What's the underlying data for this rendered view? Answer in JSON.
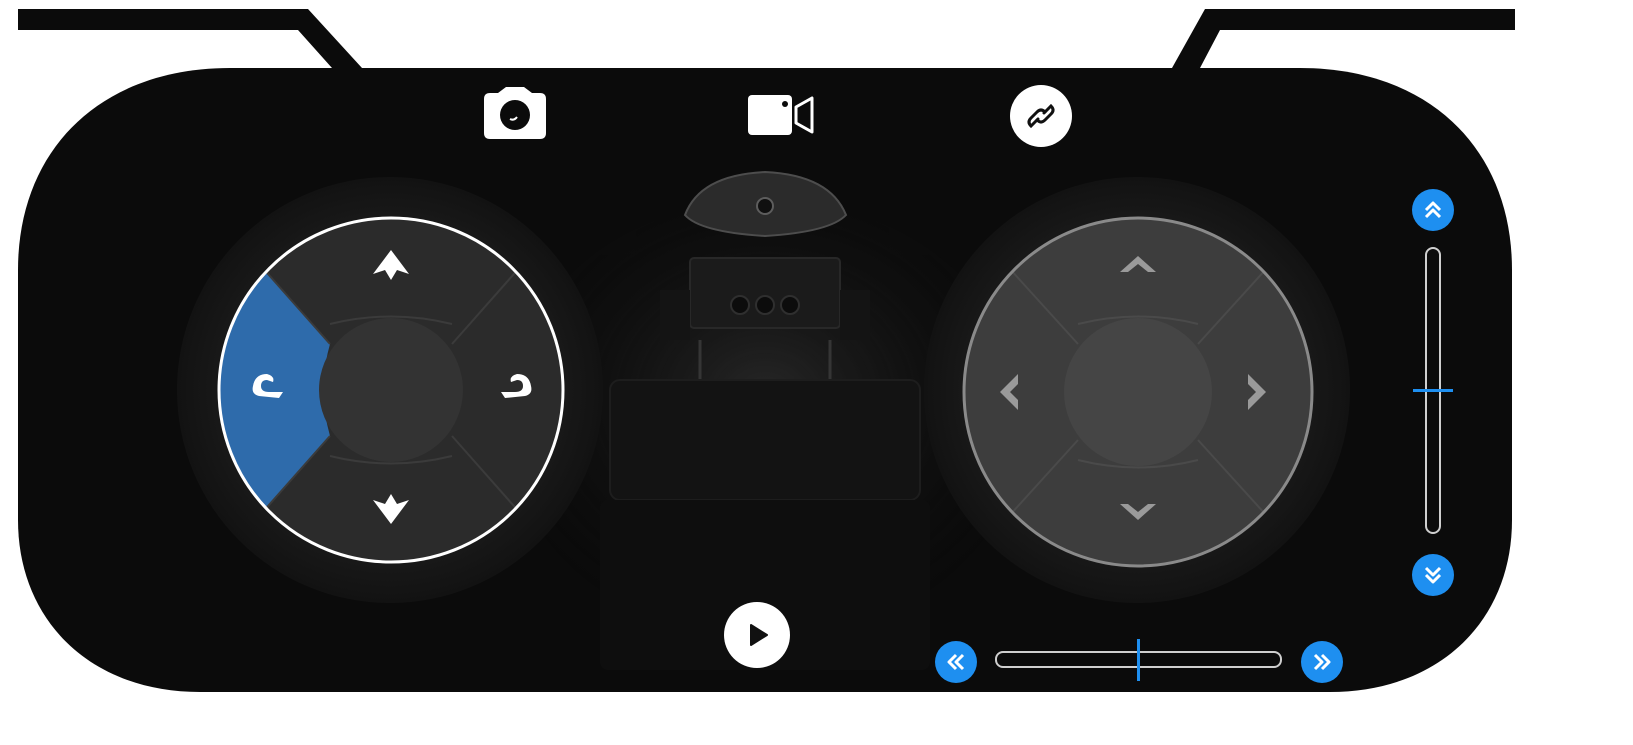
{
  "app": {
    "name": "robot-remote-controller"
  },
  "colors": {
    "body_bg": "#0b0b0b",
    "active_blue": "#2e6bab",
    "accent_blue": "#1e8ff0",
    "pad_bg": "#2a2a2a",
    "pad_ring": "#1a1a1a"
  },
  "top_bar": {
    "icons": [
      "camera-icon",
      "video-camera-icon",
      "link-icon"
    ]
  },
  "left_pad": {
    "active_direction": "rotate-left",
    "buttons": [
      "move-forward",
      "rotate-left",
      "rotate-right",
      "move-backward"
    ]
  },
  "right_pad": {
    "enabled": false,
    "buttons": [
      "look-up",
      "look-left",
      "look-right",
      "look-down"
    ]
  },
  "play_button": {
    "icon": "play-icon"
  },
  "vertical_slider": {
    "value": 0.5,
    "up_icon": "double-chevron-up-icon",
    "down_icon": "double-chevron-down-icon"
  },
  "horizontal_slider": {
    "value": 0.5,
    "left_icon": "double-chevron-left-icon",
    "right_icon": "double-chevron-right-icon"
  }
}
